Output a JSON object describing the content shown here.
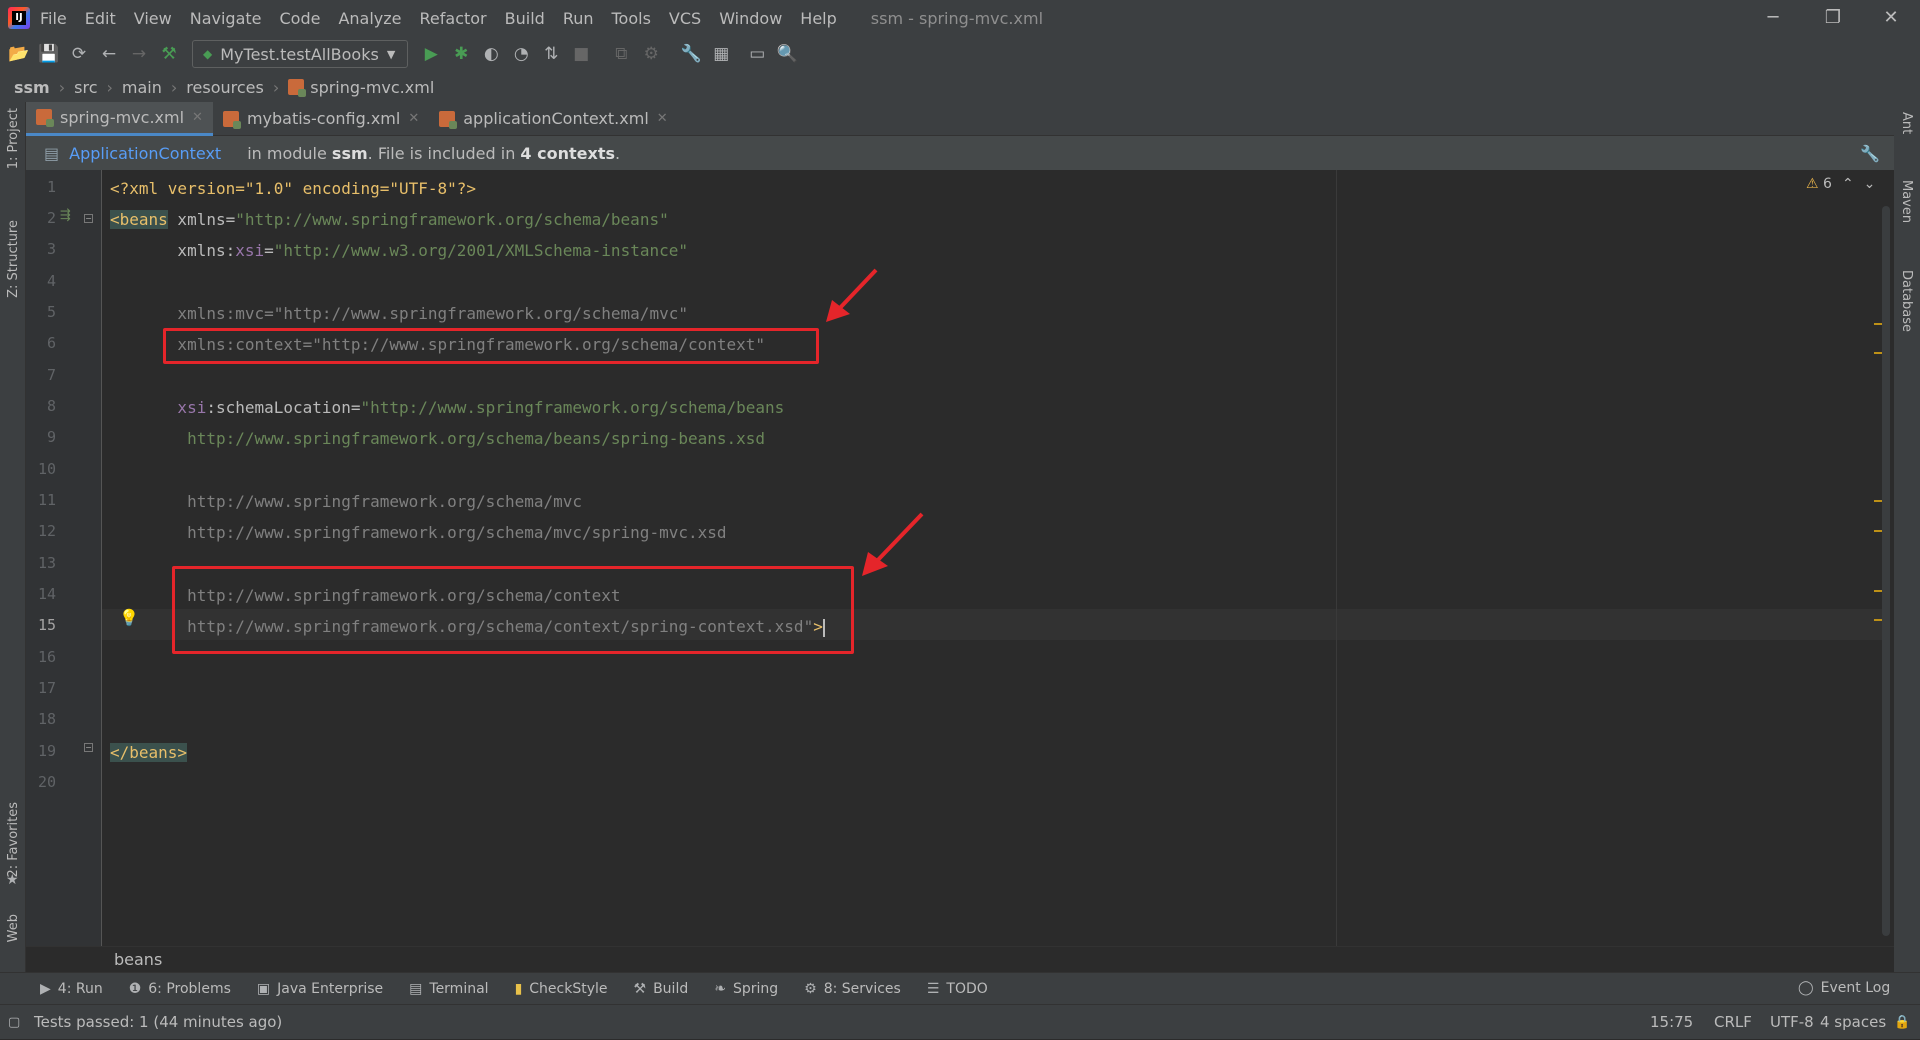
{
  "menubar": {
    "items": [
      "File",
      "Edit",
      "View",
      "Navigate",
      "Code",
      "Analyze",
      "Refactor",
      "Build",
      "Run",
      "Tools",
      "VCS",
      "Window",
      "Help"
    ],
    "title": "ssm - spring-mvc.xml"
  },
  "toolbar": {
    "run_config": "MyTest.testAllBooks"
  },
  "breadcrumb": [
    "ssm",
    "src",
    "main",
    "resources",
    "spring-mvc.xml"
  ],
  "left_strip": {
    "project": "1: Project",
    "structure": "Z: Structure",
    "favorites": "2: Favorites",
    "web": "Web"
  },
  "right_strip": {
    "ant": "Ant",
    "maven": "Maven",
    "database": "Database"
  },
  "tabs": [
    {
      "label": "spring-mvc.xml",
      "active": true
    },
    {
      "label": "mybatis-config.xml",
      "active": false
    },
    {
      "label": "applicationContext.xml",
      "active": false
    }
  ],
  "context_bar": {
    "link": "ApplicationContext",
    "text_pre": "in module ",
    "module": "ssm",
    "text_mid": ". File is included in ",
    "contexts": "4 contexts",
    "text_post": "."
  },
  "inspection": {
    "warnings": "6"
  },
  "code": {
    "line_numbers": [
      "1",
      "2",
      "3",
      "4",
      "5",
      "6",
      "7",
      "8",
      "9",
      "10",
      "11",
      "12",
      "13",
      "14",
      "15",
      "16",
      "17",
      "18",
      "19",
      "20"
    ],
    "l1_decl": "<?xml version=\"1.0\" encoding=\"UTF-8\"?>",
    "l2_tag": "<beans",
    "l2_attr": " xmlns=",
    "l2_val": "\"http://www.springframework.org/schema/beans\"",
    "l3_attr": "       xmlns:",
    "l3_ns": "xsi",
    "l3_eq": "=",
    "l3_val": "\"http://www.w3.org/2001/XMLSchema-instance\"",
    "l5": "       xmlns:mvc=\"http://www.springframework.org/schema/mvc\"",
    "l6": "       xmlns:context=\"http://www.springframework.org/schema/context\"",
    "l8_ns": "       xsi",
    "l8_attr": ":schemaLocation=",
    "l8_val": "\"http://www.springframework.org/schema/beans",
    "l9": "        http://www.springframework.org/schema/beans/spring-beans.xsd",
    "l11": "        http://www.springframework.org/schema/mvc",
    "l12": "        http://www.springframework.org/schema/mvc/spring-mvc.xsd",
    "l14": "        http://www.springframework.org/schema/context",
    "l15": "        http://www.springframework.org/schema/context/spring-context.xsd\"",
    "l15_close": ">",
    "l19": "</beans>"
  },
  "editor_breadcrumb": "beans",
  "bottom_tools": [
    {
      "label": "4: Run",
      "icon": "play-icon"
    },
    {
      "label": "6: Problems",
      "icon": "problems-icon"
    },
    {
      "label": "Java Enterprise",
      "icon": "java-enterprise-icon"
    },
    {
      "label": "Terminal",
      "icon": "terminal-icon"
    },
    {
      "label": "CheckStyle",
      "icon": "checkstyle-icon"
    },
    {
      "label": "Build",
      "icon": "build-icon"
    },
    {
      "label": "Spring",
      "icon": "spring-icon"
    },
    {
      "label": "8: Services",
      "icon": "services-icon"
    },
    {
      "label": "TODO",
      "icon": "todo-icon"
    }
  ],
  "event_log": "Event Log",
  "status": {
    "message": "Tests passed: 1 (44 minutes ago)",
    "position": "15:75",
    "line_sep": "CRLF",
    "encoding": "UTF-8",
    "indent": "4 spaces"
  },
  "colors": {
    "accent": "#4a88c7",
    "annotation": "#e5252a",
    "link": "#589df6"
  }
}
